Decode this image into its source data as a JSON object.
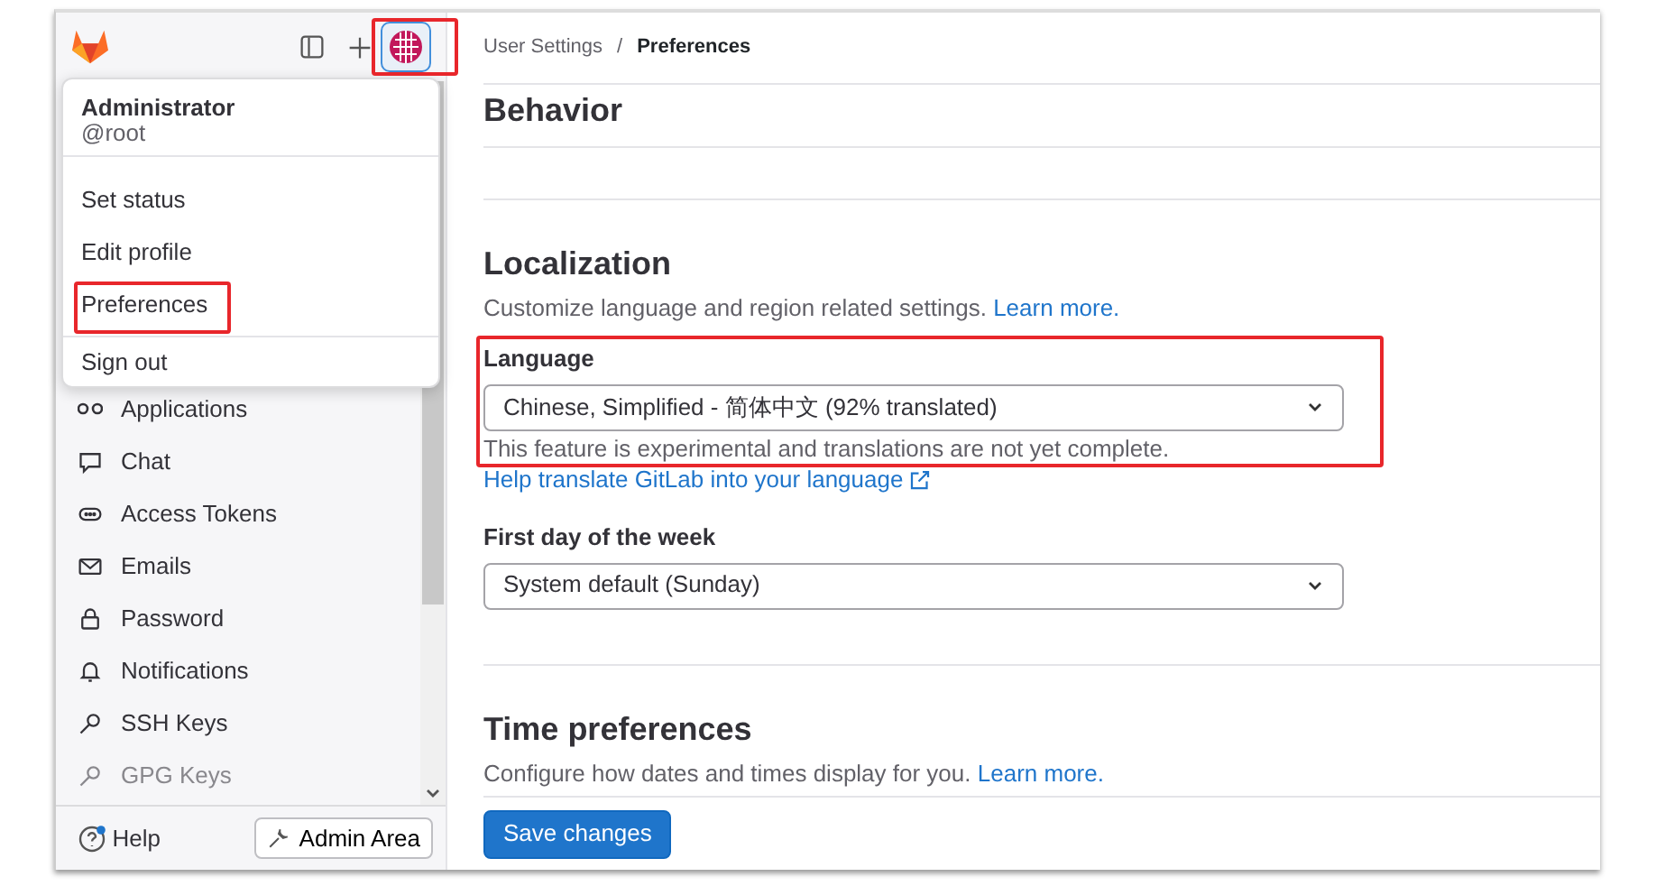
{
  "top_bar": {
    "avatar_annotated": true
  },
  "user_menu": {
    "name": "Administrator",
    "username": "@root",
    "items": [
      {
        "label": "Set status",
        "annotated": false
      },
      {
        "label": "Edit profile",
        "annotated": false
      },
      {
        "label": "Preferences",
        "annotated": true
      }
    ],
    "sign_out": "Sign out"
  },
  "sidebar": {
    "items": [
      {
        "label": "Applications",
        "kind": "apps",
        "faded": false
      },
      {
        "label": "Chat",
        "kind": "chat",
        "faded": false
      },
      {
        "label": "Access Tokens",
        "kind": "token",
        "faded": false
      },
      {
        "label": "Emails",
        "kind": "mail",
        "faded": false
      },
      {
        "label": "Password",
        "kind": "lock",
        "faded": false
      },
      {
        "label": "Notifications",
        "kind": "bell",
        "faded": false
      },
      {
        "label": "SSH Keys",
        "kind": "key",
        "faded": false
      },
      {
        "label": "GPG Keys",
        "kind": "key",
        "faded": true
      }
    ],
    "help": {
      "label": "Help",
      "notification": true
    },
    "admin_button": "Admin Area"
  },
  "breadcrumb": {
    "separator": "/",
    "items": [
      {
        "label": "User Settings",
        "current": false
      },
      {
        "label": "Preferences",
        "current": true
      }
    ]
  },
  "behavior": {
    "heading": "Behavior"
  },
  "localization": {
    "heading": "Localization",
    "description": "Customize language and region related settings.",
    "learn_more": "Learn more.",
    "language": {
      "label": "Language",
      "value": "Chinese, Simplified - 简体中文 (92% translated)",
      "help": "This feature is experimental and translations are not yet complete.",
      "annotated": true
    },
    "translate_link": "Help translate GitLab into your language",
    "first_day": {
      "label": "First day of the week",
      "value": "System default (Sunday)"
    }
  },
  "time_preferences": {
    "heading": "Time preferences",
    "description": "Configure how dates and times display for you.",
    "learn_more": "Learn more."
  },
  "save_button": "Save changes"
}
